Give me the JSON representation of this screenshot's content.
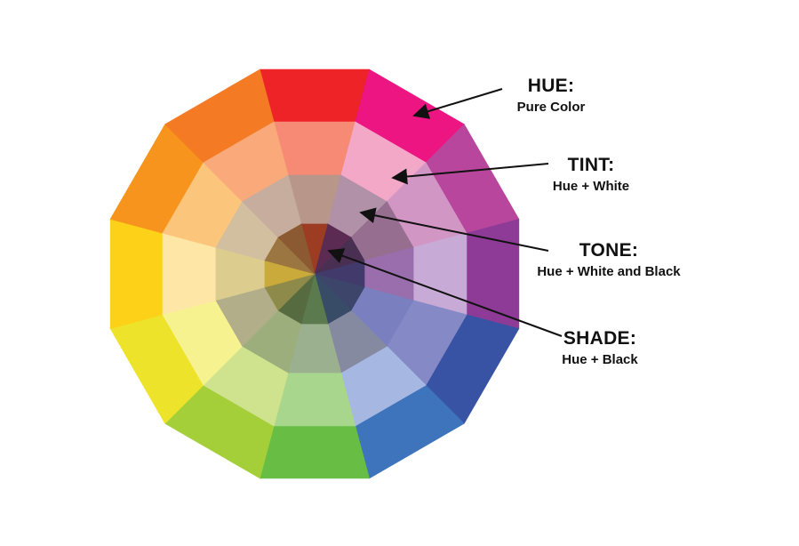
{
  "labels": {
    "hue": {
      "title": "HUE:",
      "subtitle": "Pure Color"
    },
    "tint": {
      "title": "TINT:",
      "subtitle": "Hue + White"
    },
    "tone": {
      "title": "TONE:",
      "subtitle": "Hue + White and Black"
    },
    "shade": {
      "title": "SHADE:",
      "subtitle": "Hue + Black"
    }
  },
  "wheel": {
    "hue_names": [
      "red",
      "magenta",
      "purple",
      "violet",
      "blue",
      "cobalt",
      "green",
      "yellow-green",
      "yellow",
      "amber",
      "orange",
      "red-orange"
    ],
    "rings": {
      "hue": [
        "#ee2328",
        "#ec1582",
        "#b8469c",
        "#8e3b97",
        "#3953a4",
        "#3d74bb",
        "#68bd45",
        "#a4cf39",
        "#eee32b",
        "#fcd117",
        "#f7941d",
        "#f47a24"
      ],
      "tint": [
        "#f68a74",
        "#f4a8c8",
        "#d296c5",
        "#c8aad6",
        "#8589c6",
        "#a6b8e2",
        "#a8d68c",
        "#cfe38f",
        "#f7f290",
        "#fde6a6",
        "#fcc57c",
        "#f9a97a"
      ],
      "tone": [
        "#b9968a",
        "#b191a8",
        "#966e8f",
        "#9a6eac",
        "#7a7fbf",
        "#868aa1",
        "#9bb08f",
        "#9dae7d",
        "#b1ae89",
        "#dccd8e",
        "#d2bfa0",
        "#c7ad9d"
      ],
      "shade": [
        "#9c3c22",
        "#5b2b53",
        "#493052",
        "#423a6a",
        "#3d466a",
        "#384b67",
        "#5b7a4d",
        "#566b40",
        "#8e8a4a",
        "#c9aa3a",
        "#9c7641",
        "#8b5a33"
      ]
    }
  }
}
